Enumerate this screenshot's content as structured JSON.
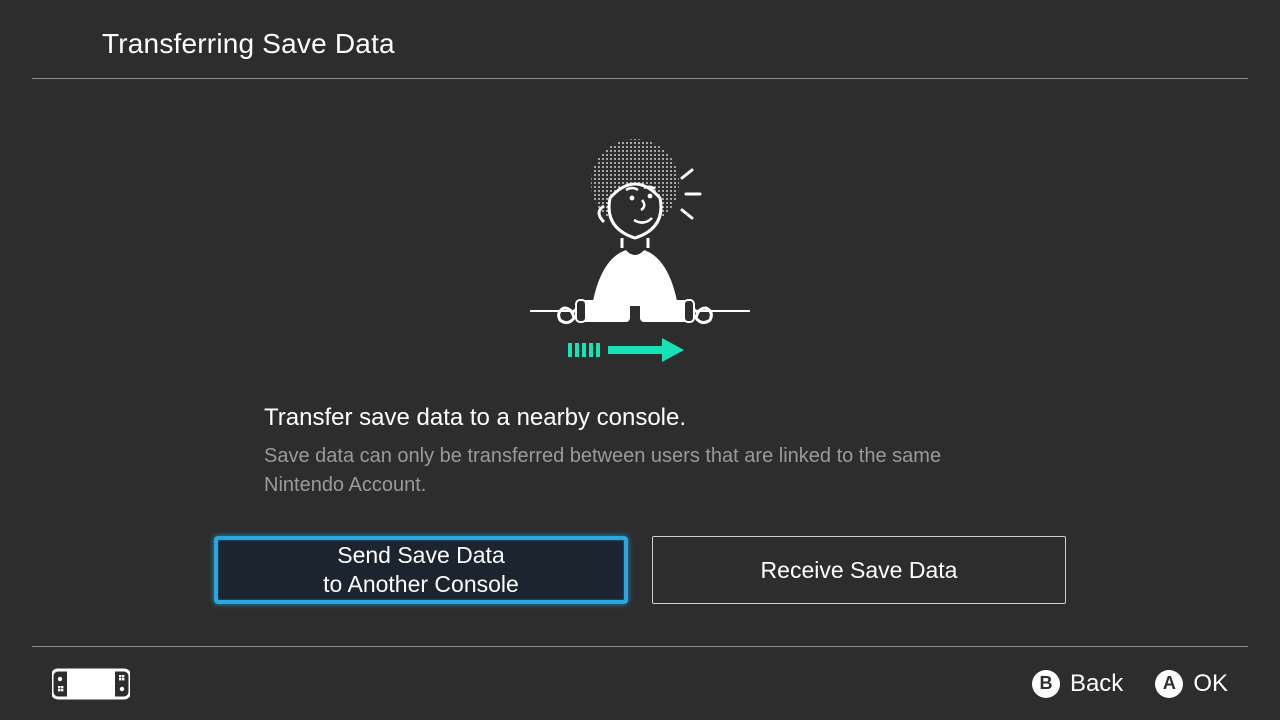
{
  "header": {
    "title": "Transferring Save Data"
  },
  "main": {
    "headline": "Transfer save data to a nearby console.",
    "subtext": "Save data can only be transferred between users that are linked to the same Nintendo Account.",
    "buttons": {
      "send_line1": "Send Save Data",
      "send_line2": "to Another Console",
      "receive": "Receive Save Data"
    },
    "illustration": {
      "name": "person-holding-controllers-illustration",
      "arrow": "transfer-arrow-icon",
      "accent_color": "#16e2b6"
    }
  },
  "footer": {
    "controller_icon": "switch-handheld-icon",
    "hints": [
      {
        "key": "B",
        "label": "Back"
      },
      {
        "key": "A",
        "label": "OK"
      }
    ]
  }
}
